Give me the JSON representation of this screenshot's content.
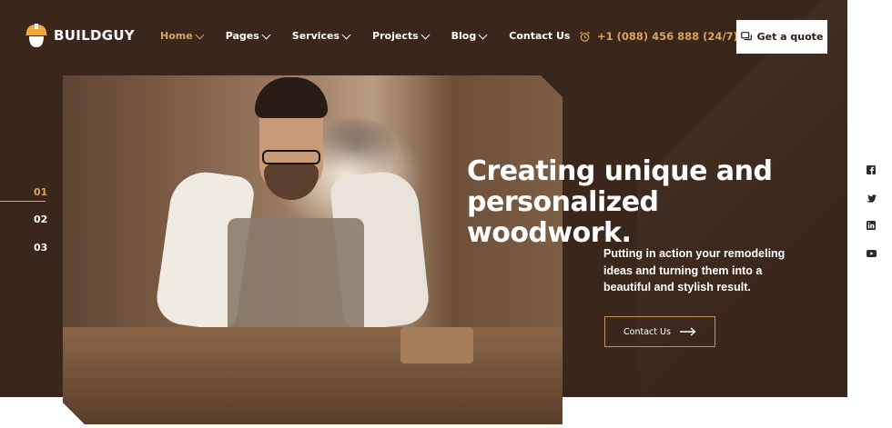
{
  "brand": {
    "name": "BUILDGUY"
  },
  "nav": {
    "items": [
      {
        "label": "Home",
        "active": true,
        "dropdown": true
      },
      {
        "label": "Pages",
        "active": false,
        "dropdown": true
      },
      {
        "label": "Services",
        "active": false,
        "dropdown": true
      },
      {
        "label": "Projects",
        "active": false,
        "dropdown": true
      },
      {
        "label": "Blog",
        "active": false,
        "dropdown": true
      },
      {
        "label": "Contact Us",
        "active": false,
        "dropdown": false
      }
    ]
  },
  "header": {
    "phone": "+1 (088) 456 888 (24/7)",
    "quote_label": "Get a quote"
  },
  "slider": {
    "numbers": [
      "01",
      "02",
      "03"
    ],
    "active_index": 0
  },
  "hero": {
    "headline_line1": "Creating unique and",
    "headline_line2": "personalized woodwork.",
    "subtext_line1": "Putting in action your remodeling",
    "subtext_line2": "ideas and turning them into a",
    "subtext_line3": "beautiful and stylish result.",
    "cta_label": "Contact Us"
  },
  "social": [
    "facebook-icon",
    "twitter-icon",
    "linkedin-icon",
    "youtube-icon"
  ],
  "colors": {
    "background": "#3b261b",
    "accent": "#d9a45d",
    "text": "#ffffff"
  }
}
